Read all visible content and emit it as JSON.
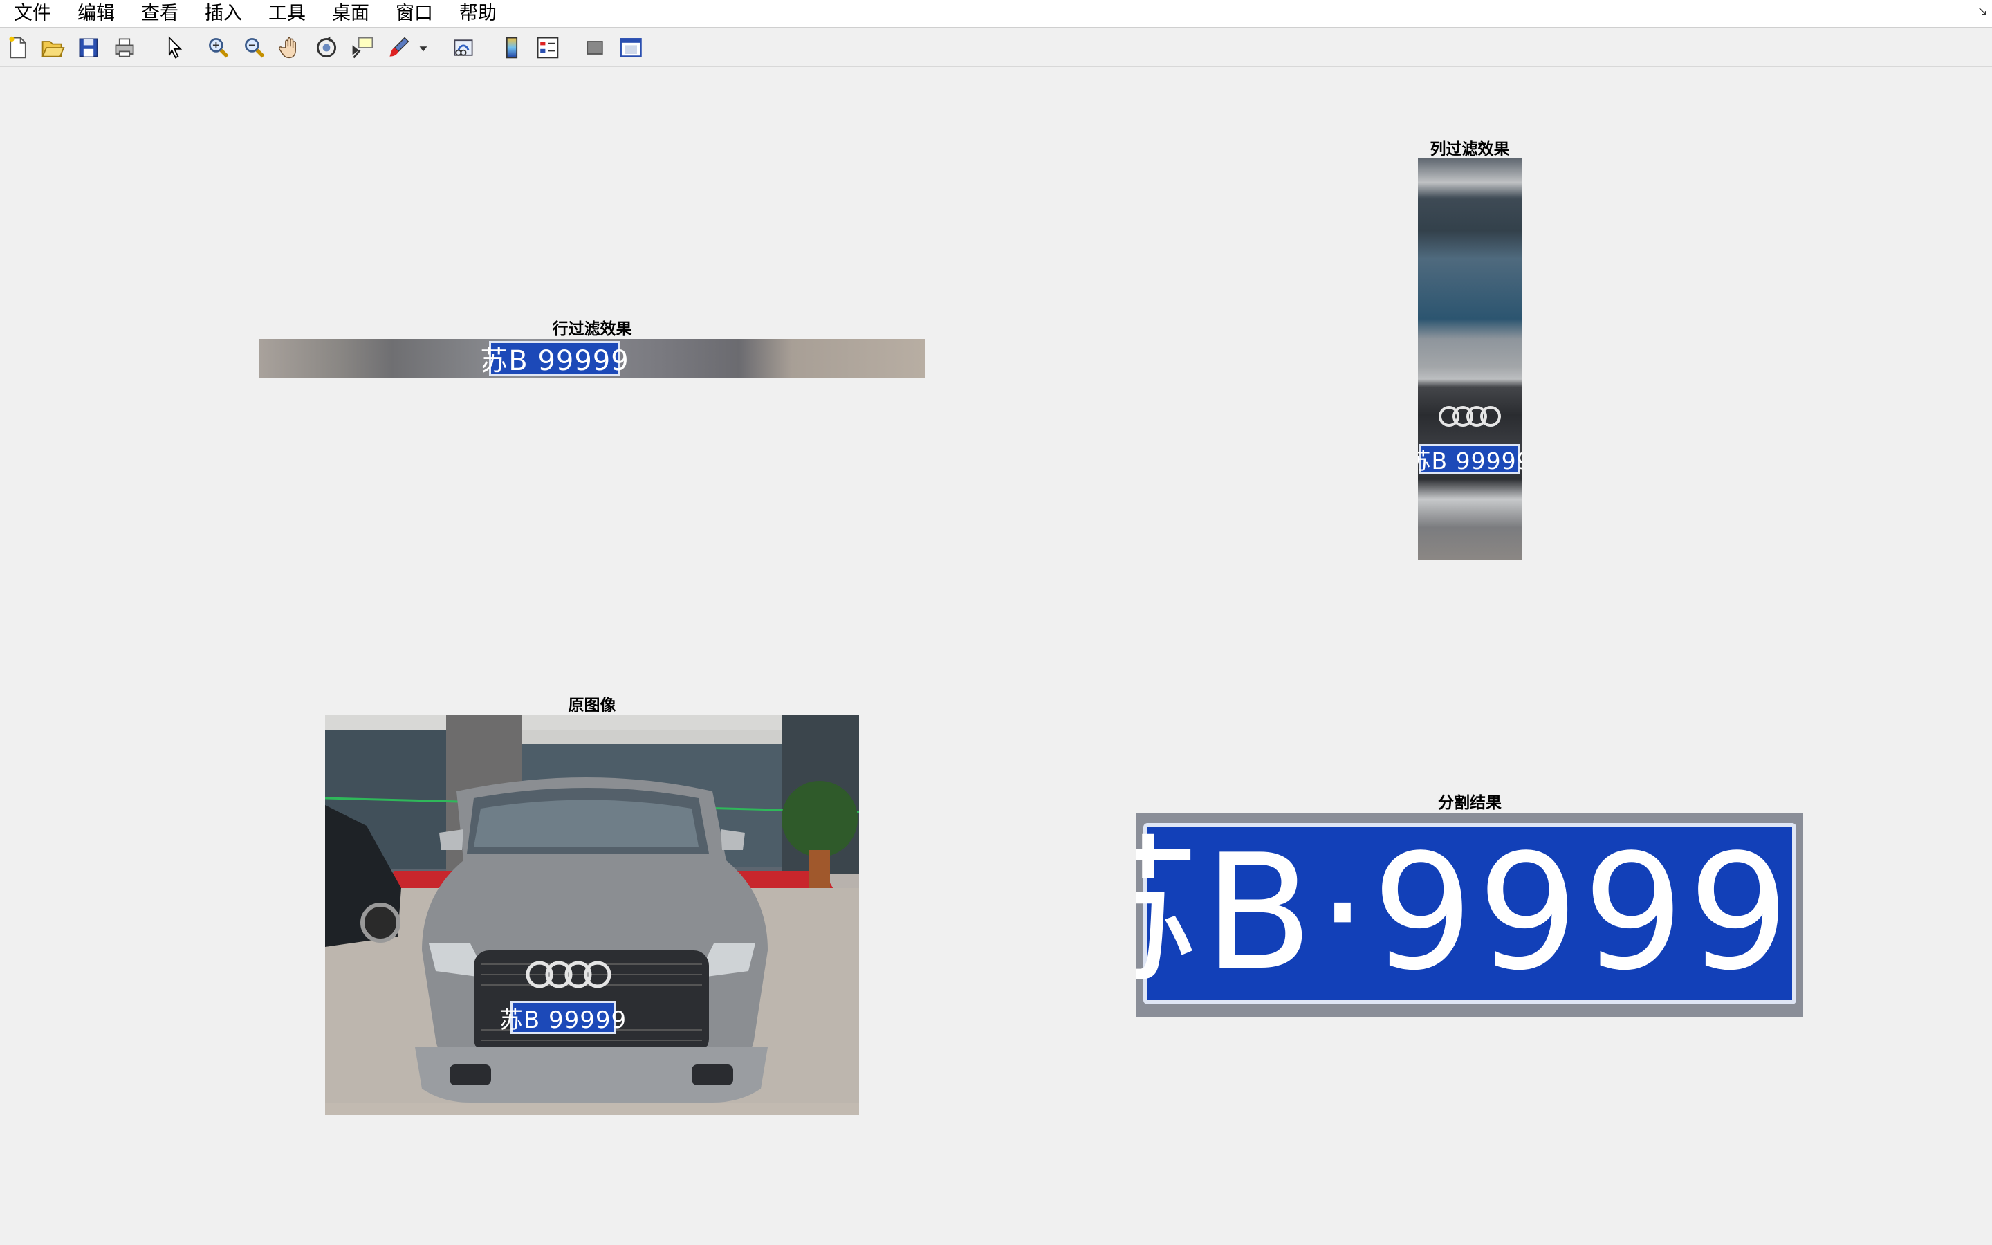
{
  "menu": {
    "items": [
      "文件",
      "编辑",
      "查看",
      "插入",
      "工具",
      "桌面",
      "窗口",
      "帮助"
    ]
  },
  "toolbar": {
    "buttons": [
      "new-figure",
      "open-file",
      "save-figure",
      "print-figure",
      "edit-plot",
      "zoom-in",
      "zoom-out",
      "pan",
      "rotate-3d",
      "data-cursor",
      "brush",
      "link-plot",
      "insert-colorbar",
      "insert-legend",
      "hide-plot-tools",
      "show-plot-tools"
    ]
  },
  "axes": {
    "row_filter": {
      "title": "行过滤效果"
    },
    "col_filter": {
      "title": "列过滤效果"
    },
    "original": {
      "title": "原图像"
    },
    "segmentation": {
      "title": "分割结果"
    }
  },
  "plate": {
    "text": "苏B·99999",
    "short": "苏B 99999",
    "province": "苏",
    "letter": "B",
    "digits": "99999",
    "color": "#1c49b8"
  }
}
